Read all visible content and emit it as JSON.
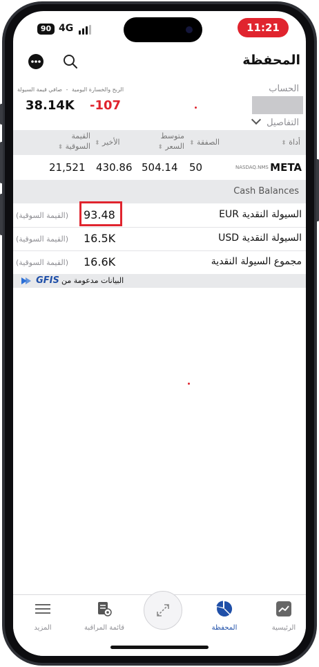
{
  "status_bar": {
    "battery": "90",
    "network": "4G",
    "time": "11:21"
  },
  "header": {
    "title": "المحفظة"
  },
  "account": {
    "label": "الحساب",
    "details": "التفاصيل",
    "pl_label": "الربح والخسارة اليومية",
    "nlv_label": "صافي قيمة السيولة",
    "nlv_value": "38.14K",
    "pl_value": "-107"
  },
  "table": {
    "columns": {
      "instrument": "أداة",
      "position": "الصفقة",
      "avg_price": "متوسط السعر",
      "last": "الأخير",
      "market_value": "القيمة السوقية"
    },
    "rows": [
      {
        "symbol": "META",
        "exchange": "NASDAQ.NMS",
        "position": "50",
        "avg_price": "504.14",
        "last": "430.86",
        "market_value": "21,521"
      }
    ]
  },
  "cash": {
    "header": "Cash Balances",
    "market_value_tag": "(القيمة السوقية)",
    "rows": [
      {
        "label": "السيولة النقدية EUR",
        "value": "93.48"
      },
      {
        "label": "السيولة النقدية USD",
        "value": "16.5K"
      },
      {
        "label": "مجموع السيولة النقدية",
        "value": "16.6K"
      }
    ]
  },
  "data_source": {
    "text": "البيانات مدعومة من",
    "brand": "GFIS"
  },
  "nav": {
    "items": [
      {
        "label": "الرئيسية"
      },
      {
        "label": "المحفظة"
      },
      {
        "label": "قائمة المراقبة"
      },
      {
        "label": "المزيد"
      }
    ]
  },
  "colors": {
    "negative": "#e0242e",
    "accent": "#1f4fa8",
    "highlight_box": "#e0242e"
  }
}
